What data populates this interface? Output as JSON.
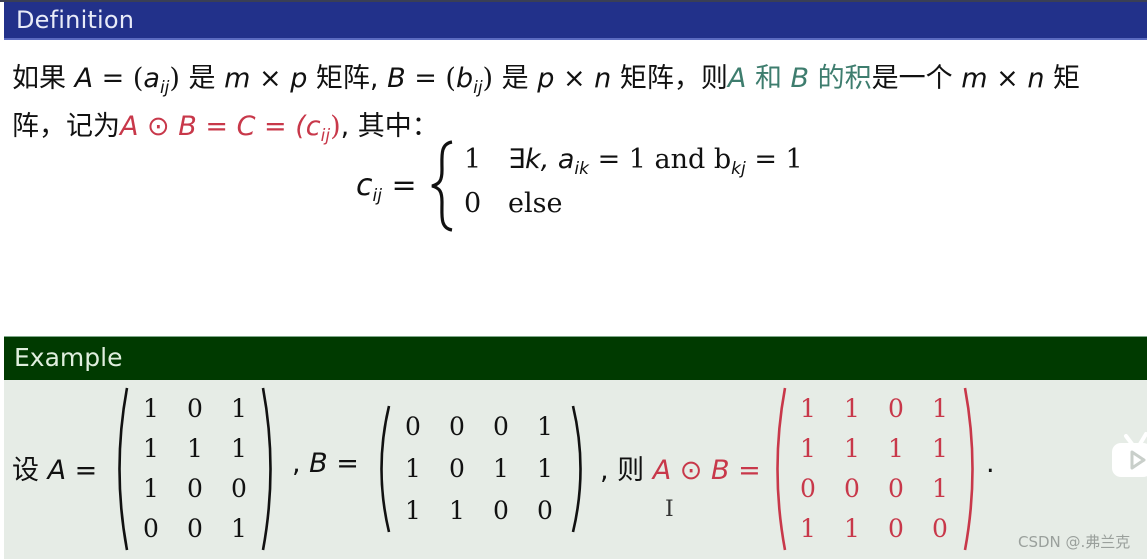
{
  "definition": {
    "title": "Definition",
    "line1": {
      "p1": "如果 ",
      "A": "A",
      "eq1": " = (",
      "a": "a",
      "a_sub": "ij",
      "close1": ") 是 ",
      "mxp": "m × p",
      "p2": " 矩阵, ",
      "B": "B",
      "eq2": " = (",
      "b": "b",
      "b_sub": "ij",
      "close2": ") 是 ",
      "pxn": "p × n",
      "p3": " 矩阵，则",
      "green_A": "A",
      "green_he": " 和 ",
      "green_B": "B",
      "green_de": " 的积",
      "p4": "是一个 ",
      "mxn": "m × n",
      "p5": " 矩"
    },
    "line2": {
      "p1": "阵，记为",
      "red_expr": "A ⊙ B = C = (",
      "c": "c",
      "c_sub": "ij",
      "red_close": ")",
      "p2": ", 其中："
    },
    "formula": {
      "lhs": "c",
      "lhs_sub": "ij",
      "eq": " =",
      "case1_value": "1",
      "case1_cond_pre": "∃k, a",
      "case1_cond_sub1": "ik",
      "case1_cond_mid": " = 1 and b",
      "case1_cond_sub2": "kj",
      "case1_cond_post": " = 1",
      "case2_value": "0",
      "case2_cond": "else"
    }
  },
  "example": {
    "title": "Example",
    "prefix": "设 ",
    "A_label": "A =",
    "sep_B": ", ",
    "B_label": "B =",
    "sep_then": ", 则 ",
    "result_label": "A ⊙ B =",
    "period": ".",
    "matrix_A": [
      [
        1,
        0,
        1
      ],
      [
        1,
        1,
        1
      ],
      [
        1,
        0,
        0
      ],
      [
        0,
        0,
        1
      ]
    ],
    "matrix_B": [
      [
        0,
        0,
        0,
        1
      ],
      [
        1,
        0,
        1,
        1
      ],
      [
        1,
        1,
        0,
        0
      ]
    ],
    "matrix_C": [
      [
        1,
        1,
        0,
        1
      ],
      [
        1,
        1,
        1,
        1
      ],
      [
        0,
        0,
        0,
        1
      ],
      [
        1,
        1,
        0,
        0
      ]
    ]
  },
  "overlay": {
    "cursor": "I",
    "watermark": "CSDN @.弗兰克",
    "player_icon": "tv-play-icon"
  },
  "colors": {
    "definition_header": "#22318a",
    "example_header": "#003a00",
    "example_body": "#e6ece6",
    "highlight_green": "#3e7d6e",
    "highlight_red": "#c8384a"
  }
}
